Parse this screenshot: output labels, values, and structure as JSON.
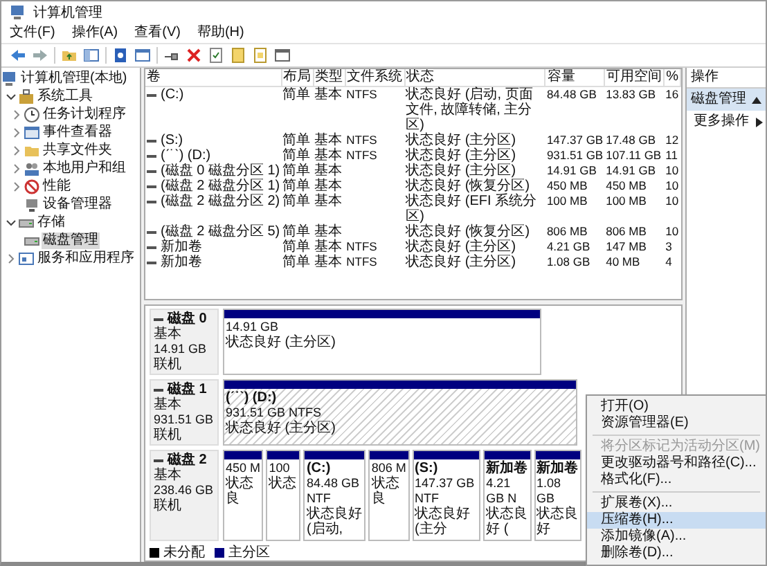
{
  "window": {
    "title": "计算机管理"
  },
  "menu": [
    "文件(F)",
    "操作(A)",
    "查看(V)",
    "帮助(H)"
  ],
  "tree": {
    "label": "计算机管理(本地)",
    "children": [
      {
        "label": "系统工具",
        "kind": "branch",
        "expanded": true,
        "selected": false,
        "children": [
          {
            "label": "任务计划程序",
            "kind": "branch",
            "expanded": false,
            "selected": false
          },
          {
            "label": "事件查看器",
            "kind": "branch",
            "expanded": false,
            "selected": false
          },
          {
            "label": "共享文件夹",
            "kind": "branch",
            "expanded": false,
            "selected": false
          },
          {
            "label": "本地用户和组",
            "kind": "branch",
            "expanded": false,
            "selected": false
          },
          {
            "label": "性能",
            "kind": "branch",
            "expanded": false,
            "selected": false
          },
          {
            "label": "设备管理器",
            "kind": "leaf",
            "selected": false
          }
        ]
      },
      {
        "label": "存储",
        "kind": "branch",
        "expanded": true,
        "selected": false,
        "children": [
          {
            "label": "磁盘管理",
            "kind": "leaf",
            "selected": true
          }
        ]
      },
      {
        "label": "服务和应用程序",
        "kind": "branch",
        "expanded": false,
        "selected": false
      }
    ]
  },
  "volumes": {
    "columns": [
      "卷",
      "布局",
      "类型",
      "文件系统",
      "状态",
      "容量",
      "可用空间",
      "%"
    ],
    "rows": [
      {
        "volume": "(C:)",
        "layout": "简单",
        "type": "基本",
        "filesystem": "NTFS",
        "status": "状态良好 (启动, 页面文件, 故障转储, 主分区)",
        "capacity": "84.48 GB",
        "free": "13.83 GB",
        "percent": "16"
      },
      {
        "volume": "(S:)",
        "layout": "简单",
        "type": "基本",
        "filesystem": "NTFS",
        "status": "状态良好 (主分区)",
        "capacity": "147.37 GB",
        "free": "17.48 GB",
        "percent": "12"
      },
      {
        "volume": "(ˊ˙ˋ) (D:)",
        "layout": "简单",
        "type": "基本",
        "filesystem": "NTFS",
        "status": "状态良好 (主分区)",
        "capacity": "931.51 GB",
        "free": "107.11 GB",
        "percent": "11"
      },
      {
        "volume": "(磁盘 0 磁盘分区 1)",
        "layout": "简单",
        "type": "基本",
        "status": "状态良好 (主分区)",
        "capacity": "14.91 GB",
        "free": "14.91 GB",
        "percent": "10"
      },
      {
        "volume": "(磁盘 2 磁盘分区 1)",
        "layout": "简单",
        "type": "基本",
        "status": "状态良好 (恢复分区)",
        "capacity": "450 MB",
        "free": "450 MB",
        "percent": "10"
      },
      {
        "volume": "(磁盘 2 磁盘分区 2)",
        "layout": "简单",
        "type": "基本",
        "status": "状态良好 (EFI 系统分区)",
        "capacity": "100 MB",
        "free": "100 MB",
        "percent": "10"
      },
      {
        "volume": "(磁盘 2 磁盘分区 5)",
        "layout": "简单",
        "type": "基本",
        "status": "状态良好 (恢复分区)",
        "capacity": "806 MB",
        "free": "806 MB",
        "percent": "10"
      },
      {
        "volume": "新加卷",
        "layout": "简单",
        "type": "基本",
        "filesystem": "NTFS",
        "status": "状态良好 (主分区)",
        "capacity": "4.21 GB",
        "free": "147 MB",
        "percent": "3"
      },
      {
        "volume": "新加卷",
        "layout": "简单",
        "type": "基本",
        "filesystem": "NTFS",
        "status": "状态良好 (主分区)",
        "capacity": "1.08 GB",
        "free": "40 MB",
        "percent": "4"
      }
    ]
  },
  "disks": [
    {
      "name": "磁盘 0",
      "type": "基本",
      "size": "14.91 GB",
      "state": "联机",
      "partitions": [
        {
          "kind": "primary",
          "selected": false,
          "size": "14.91 GB",
          "status": "状态良好 (主分区)"
        }
      ]
    },
    {
      "name": "磁盘 1",
      "type": "基本",
      "size": "931.51 GB",
      "state": "联机",
      "partitions": [
        {
          "kind": "primary",
          "selected": true,
          "label": "(ˊ˙ˋ) (D:)",
          "size": "931.51 GB NTFS",
          "status": "状态良好 (主分区)"
        }
      ]
    },
    {
      "name": "磁盘 2",
      "type": "基本",
      "size": "238.46 GB",
      "state": "联机",
      "partitions": [
        {
          "kind": "primary",
          "selected": false,
          "size": "450 M",
          "status": "状态良"
        },
        {
          "kind": "primary",
          "selected": false,
          "size": "100",
          "status": "状态"
        },
        {
          "kind": "primary",
          "selected": false,
          "label": "(C:)",
          "size": "84.48 GB NTF",
          "status": "状态良好 (启动,"
        },
        {
          "kind": "primary",
          "selected": false,
          "size": "806 M",
          "status": "状态良"
        },
        {
          "kind": "primary",
          "selected": false,
          "label": "(S:)",
          "size": "147.37 GB NTF",
          "status": "状态良好 (主分"
        },
        {
          "kind": "primary",
          "selected": false,
          "label": "新加卷",
          "size": "4.21 GB N",
          "status": "状态良好 ("
        },
        {
          "kind": "primary",
          "selected": false,
          "label": "新加卷",
          "size": "1.08 GB",
          "status": "状态良好"
        }
      ]
    }
  ],
  "legend": [
    {
      "label": "未分配",
      "color": "#000000"
    },
    {
      "label": "主分区",
      "color": "#000080"
    }
  ],
  "actions": {
    "header": "操作",
    "section": "磁盘管理",
    "items": [
      "更多操作"
    ]
  },
  "context_menu": {
    "groups": [
      [
        {
          "label": "打开(O)",
          "disabled": false,
          "selected": false
        },
        {
          "label": "资源管理器(E)",
          "disabled": false,
          "selected": false
        }
      ],
      [
        {
          "label": "将分区标记为活动分区(M)",
          "disabled": true,
          "selected": false
        },
        {
          "label": "更改驱动器号和路径(C)...",
          "disabled": false,
          "selected": false
        },
        {
          "label": "格式化(F)...",
          "disabled": false,
          "selected": false
        }
      ],
      [
        {
          "label": "扩展卷(X)...",
          "disabled": false,
          "selected": false
        },
        {
          "label": "压缩卷(H)...",
          "disabled": false,
          "selected": true
        },
        {
          "label": "添加镜像(A)...",
          "disabled": false,
          "selected": false
        },
        {
          "label": "删除卷(D)...",
          "disabled": false,
          "selected": false
        }
      ]
    ]
  }
}
